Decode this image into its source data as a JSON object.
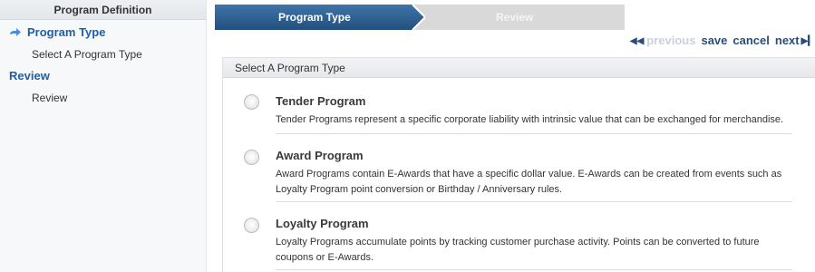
{
  "sidebar": {
    "header": "Program Definition",
    "sections": [
      {
        "label": "Program Type",
        "active": true,
        "items": [
          "Select A Program Type"
        ]
      },
      {
        "label": "Review",
        "active": false,
        "items": [
          "Review"
        ]
      }
    ]
  },
  "wizard": {
    "steps": [
      "Program Type",
      "Review"
    ],
    "current_step": "Program Type"
  },
  "nav": {
    "previous": "previous",
    "save": "save",
    "cancel": "cancel",
    "next": "next"
  },
  "panel": {
    "title": "Select A Program Type",
    "options": [
      {
        "title": "Tender Program",
        "description": "Tender Programs represent a specific corporate liability with intrinsic value that can be exchanged for merchandise."
      },
      {
        "title": "Award Program",
        "description": "Award Programs contain E-Awards that have a specific dollar value. E-Awards can be created from events such as Loyalty Program point conversion or Birthday / Anniversary rules."
      },
      {
        "title": "Loyalty Program",
        "description": "Loyalty Programs accumulate points by tracking customer purchase activity. Points can be converted to future coupons or E-Awards."
      }
    ]
  },
  "colors": {
    "active_step": "#2f5e8e",
    "link": "#2a4d78",
    "sidebar_link": "#1f5fa8",
    "disabled_link": "#c9d1dc"
  }
}
